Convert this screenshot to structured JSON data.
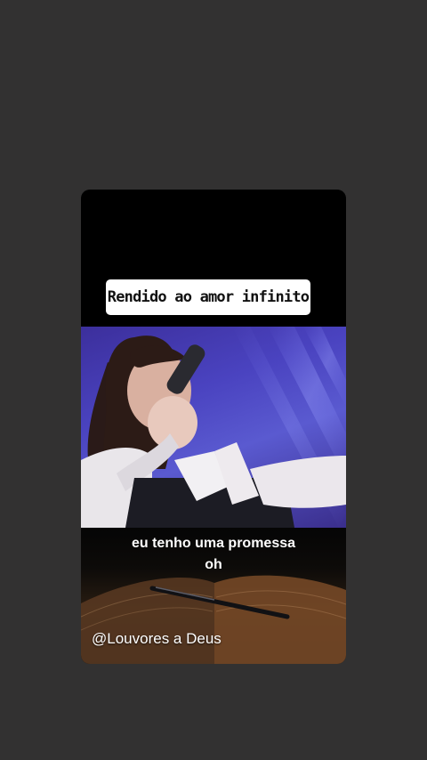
{
  "story": {
    "title_sticker": "Rendido ao amor infinito",
    "lyrics": {
      "line1": "eu tenho uma promessa",
      "line2": "oh"
    },
    "watermark": "@Louvores a Deus"
  },
  "media": {
    "video_frame": "singer-with-microphone",
    "background_frame": "open-bible-with-pen"
  },
  "colors": {
    "page_background": "#323131",
    "card_background": "#000000",
    "sticker_background": "#ffffff",
    "text_white": "#ffffff",
    "stage_light": "#4a43c0"
  }
}
